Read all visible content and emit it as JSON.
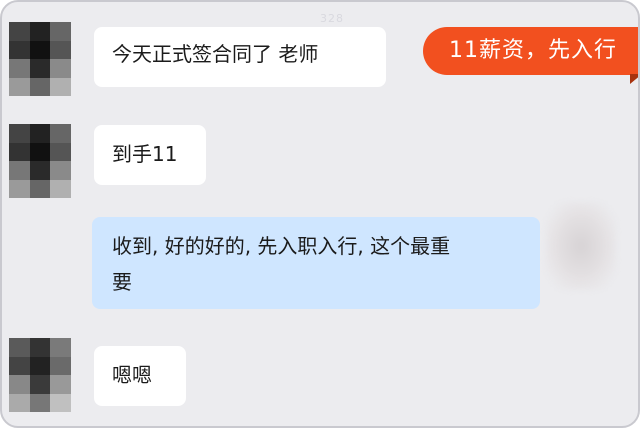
{
  "watermark": "328",
  "tag": {
    "label": "11薪资，先入行",
    "color": "#f2501f"
  },
  "messages": [
    {
      "side": "left",
      "text": "今天正式签合同了 老师"
    },
    {
      "side": "left",
      "text": "到手11"
    },
    {
      "side": "right",
      "line1": "收到, 好的好的, 先入职入行, 这个最重",
      "line2": "要"
    },
    {
      "side": "left",
      "text": "嗯嗯"
    }
  ],
  "colors": {
    "background": "#ececef",
    "incoming_bubble": "#ffffff",
    "outgoing_bubble": "#cfe6ff"
  }
}
